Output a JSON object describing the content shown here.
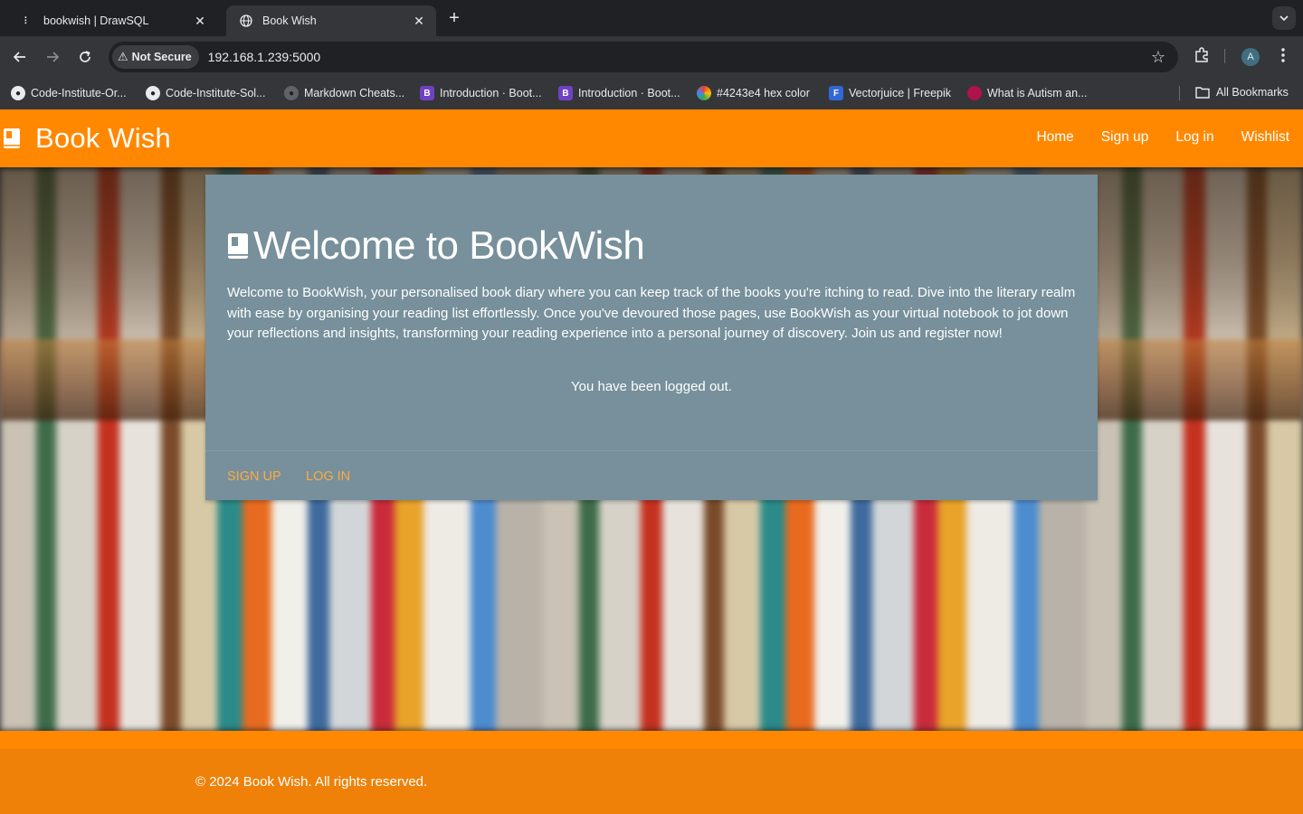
{
  "browser": {
    "tabs": [
      {
        "title": "bookwish | DrawSQL",
        "icon": "drawsql-icon",
        "active": false
      },
      {
        "title": "Book Wish",
        "icon": "globe-icon",
        "active": true
      }
    ],
    "address": {
      "security_label": "Not Secure",
      "url": "192.168.1.239:5000"
    },
    "profile_initial": "A",
    "bookmarks": [
      {
        "label": "Code-Institute-Or...",
        "icon": "github-icon"
      },
      {
        "label": "Code-Institute-Sol...",
        "icon": "github-icon"
      },
      {
        "label": "Markdown Cheats...",
        "icon": "github-icon"
      },
      {
        "label": "Introduction · Boot...",
        "icon": "bootstrap-icon",
        "glyph": "B"
      },
      {
        "label": "Introduction · Boot...",
        "icon": "bootstrap-icon",
        "glyph": "B"
      },
      {
        "label": "#4243e4 hex color",
        "icon": "color-wheel-icon"
      },
      {
        "label": "Vectorjuice | Freepik",
        "icon": "freepik-icon",
        "glyph": "F"
      },
      {
        "label": "What is Autism an...",
        "icon": "autism-site-icon"
      }
    ],
    "all_bookmarks_label": "All Bookmarks"
  },
  "site": {
    "brand": "Book Wish",
    "nav": [
      "Home",
      "Sign up",
      "Log in",
      "Wishlist"
    ],
    "accent_color": "#ff8800",
    "card_color": "#77909b"
  },
  "card": {
    "title": "Welcome to BookWish",
    "body": "Welcome to BookWish, your personalised book diary where you can keep track of the books you're itching to read. Dive into the literary realm with ease by organising your reading list effortlessly. Once you've devoured those pages, use BookWish as your virtual notebook to jot down your reflections and insights, transforming your reading experience into a personal journey of discovery. Join us and register now!",
    "message": "You have been logged out.",
    "actions": [
      "Sign up",
      "Log in"
    ]
  },
  "footer": {
    "text": "© 2024 Book Wish. All rights reserved."
  }
}
